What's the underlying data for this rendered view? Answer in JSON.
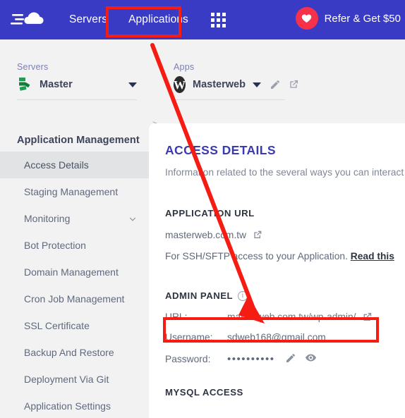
{
  "header": {
    "logo_name": "cloudways-cloud-logo",
    "nav": [
      {
        "label": "Servers",
        "name": "nav-servers"
      },
      {
        "label": "Applications",
        "name": "nav-applications"
      }
    ],
    "grid_icon": "app-grid-icon",
    "refer": {
      "label": "Refer & Get $50",
      "icon": "heart-icon",
      "badge_color": "#f8314a"
    },
    "bg_color": "#3a3bc4"
  },
  "breadcrumb": {
    "servers": {
      "label": "Servers",
      "value": "Master",
      "icon": "server-stack-icon",
      "caret": "chevron-down-icon"
    },
    "separator": ">",
    "apps": {
      "label": "Apps",
      "value": "Masterweb",
      "icon": "wordpress-icon",
      "caret": "chevron-down-icon",
      "edit_icon": "pencil-icon",
      "open_icon": "external-link-icon"
    }
  },
  "sidebar": {
    "title": "Application Management",
    "items": [
      {
        "label": "Access Details",
        "name": "sidebar-item-access-details",
        "active": true
      },
      {
        "label": "Staging Management",
        "name": "sidebar-item-staging-management",
        "active": false
      },
      {
        "label": "Monitoring",
        "name": "sidebar-item-monitoring",
        "active": false,
        "chevron": true
      },
      {
        "label": "Bot Protection",
        "name": "sidebar-item-bot-protection",
        "active": false
      },
      {
        "label": "Domain Management",
        "name": "sidebar-item-domain-management",
        "active": false
      },
      {
        "label": "Cron Job Management",
        "name": "sidebar-item-cron-job-management",
        "active": false
      },
      {
        "label": "SSL Certificate",
        "name": "sidebar-item-ssl-certificate",
        "active": false
      },
      {
        "label": "Backup And Restore",
        "name": "sidebar-item-backup-and-restore",
        "active": false
      },
      {
        "label": "Deployment Via Git",
        "name": "sidebar-item-deployment-via-git",
        "active": false
      },
      {
        "label": "Application Settings",
        "name": "sidebar-item-application-settings",
        "active": false
      }
    ]
  },
  "main": {
    "title": "ACCESS DETAILS",
    "title_color": "#3a3bb0",
    "subtitle": "Information related to the several ways you can interact",
    "application_url": {
      "section_title": "APPLICATION URL",
      "url": "masterweb.com.tw",
      "open_icon": "external-link-icon",
      "ssh_text": "For SSH/SFTP access to your Application.",
      "ssh_link": "Read this"
    },
    "admin_panel": {
      "section_title": "ADMIN PANEL",
      "info_icon": "info-circle-icon",
      "url_label": "URL:",
      "url_value": "masterweb.com.tw/wp-admin/",
      "url_open_icon": "external-link-icon",
      "username_label": "Username:",
      "username_value": "sdweb168@gmail.com",
      "password_label": "Password:",
      "password_value": "••••••••••",
      "password_edit_icon": "pencil-icon",
      "password_reveal_icon": "eye-icon"
    },
    "mysql": {
      "section_title": "MYSQL ACCESS"
    }
  },
  "annotations": {
    "highlight_color": "#f41c13",
    "boxes": [
      {
        "name": "applications-highlight-box",
        "target": "Applications"
      },
      {
        "name": "admin-url-highlight-box",
        "target": "URL: masterweb.com.tw/wp-admin/"
      }
    ],
    "arrow": {
      "name": "pointer-arrow",
      "from": "Applications",
      "to": "URL: masterweb.com.tw/wp-admin/"
    }
  }
}
